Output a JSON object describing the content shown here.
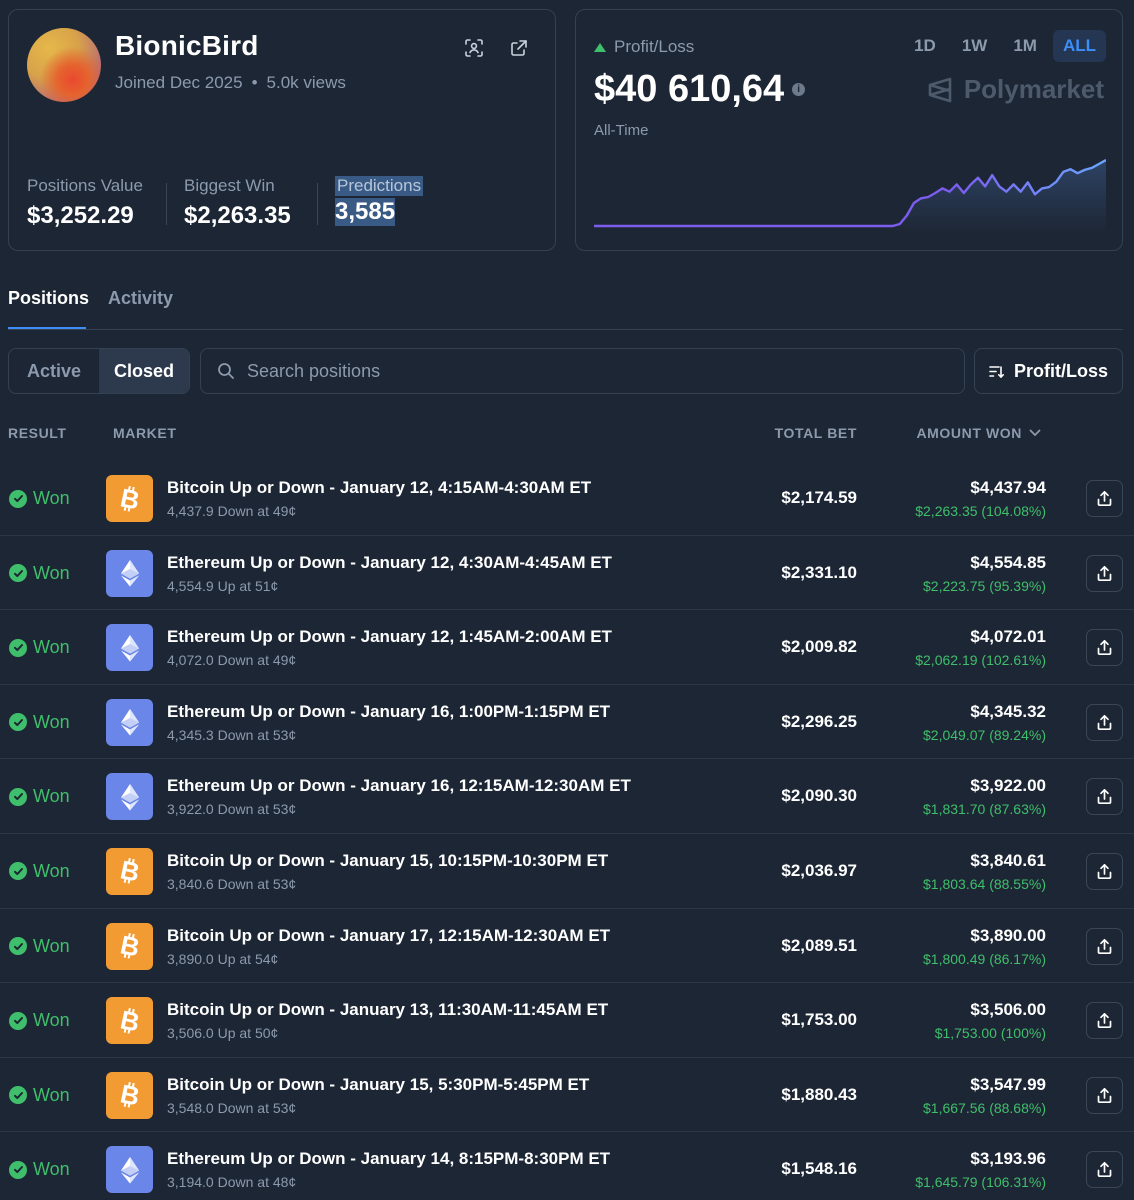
{
  "profile": {
    "username": "BionicBird",
    "joined": "Joined Dec 2025",
    "separator": "•",
    "views": "5.0k views",
    "icons": [
      "scan-icon",
      "external-link-icon"
    ],
    "stats": [
      {
        "label": "Positions Value",
        "value": "$3,252.29"
      },
      {
        "label": "Biggest Win",
        "value": "$2,263.35"
      },
      {
        "label": "Predictions",
        "value": "3,585"
      }
    ]
  },
  "pnl": {
    "label": "Profit/Loss",
    "value": "$40 610,64",
    "info": "i",
    "period": "All-Time",
    "ranges": [
      "1D",
      "1W",
      "1M",
      "ALL"
    ],
    "active_range": "ALL",
    "brand": "Polymarket",
    "trend_color": "#3fbf6b",
    "line_color": "#7d5cf0",
    "line_color_end": "#6aa7ff"
  },
  "tabs": {
    "positions": "Positions",
    "activity": "Activity",
    "active": "Positions"
  },
  "filter": {
    "active": "Active",
    "closed": "Closed",
    "selected": "Closed"
  },
  "search": {
    "placeholder": "Search positions"
  },
  "sort": {
    "label": "Profit/Loss"
  },
  "columns": {
    "result": "RESULT",
    "market": "MARKET",
    "total_bet": "TOTAL BET",
    "amount_won": "AMOUNT WON"
  },
  "colors": {
    "won": "#3fbf6b",
    "btc": "#f29b33",
    "eth": "#6a86e8",
    "accent": "#3d8ef7"
  },
  "rows": [
    {
      "result": "Won",
      "coin": "btc",
      "title": "Bitcoin Up or Down - January 12, 4:15AM-4:30AM ET",
      "sub": "4,437.9 Down at 49¢",
      "bet": "$2,174.59",
      "won": "$4,437.94",
      "gain": "$2,263.35 (104.08%)"
    },
    {
      "result": "Won",
      "coin": "eth",
      "title": "Ethereum Up or Down - January 12, 4:30AM-4:45AM ET",
      "sub": "4,554.9 Up at 51¢",
      "bet": "$2,331.10",
      "won": "$4,554.85",
      "gain": "$2,223.75 (95.39%)"
    },
    {
      "result": "Won",
      "coin": "eth",
      "title": "Ethereum Up or Down - January 12, 1:45AM-2:00AM ET",
      "sub": "4,072.0 Down at 49¢",
      "bet": "$2,009.82",
      "won": "$4,072.01",
      "gain": "$2,062.19 (102.61%)"
    },
    {
      "result": "Won",
      "coin": "eth",
      "title": "Ethereum Up or Down - January 16, 1:00PM-1:15PM ET",
      "sub": "4,345.3 Down at 53¢",
      "bet": "$2,296.25",
      "won": "$4,345.32",
      "gain": "$2,049.07 (89.24%)"
    },
    {
      "result": "Won",
      "coin": "eth",
      "title": "Ethereum Up or Down - January 16, 12:15AM-12:30AM ET",
      "sub": "3,922.0 Down at 53¢",
      "bet": "$2,090.30",
      "won": "$3,922.00",
      "gain": "$1,831.70 (87.63%)"
    },
    {
      "result": "Won",
      "coin": "btc",
      "title": "Bitcoin Up or Down - January 15, 10:15PM-10:30PM ET",
      "sub": "3,840.6 Down at 53¢",
      "bet": "$2,036.97",
      "won": "$3,840.61",
      "gain": "$1,803.64 (88.55%)"
    },
    {
      "result": "Won",
      "coin": "btc",
      "title": "Bitcoin Up or Down - January 17, 12:15AM-12:30AM ET",
      "sub": "3,890.0 Up at 54¢",
      "bet": "$2,089.51",
      "won": "$3,890.00",
      "gain": "$1,800.49 (86.17%)"
    },
    {
      "result": "Won",
      "coin": "btc",
      "title": "Bitcoin Up or Down - January 13, 11:30AM-11:45AM ET",
      "sub": "3,506.0 Up at 50¢",
      "bet": "$1,753.00",
      "won": "$3,506.00",
      "gain": "$1,753.00 (100%)"
    },
    {
      "result": "Won",
      "coin": "btc",
      "title": "Bitcoin Up or Down - January 15, 5:30PM-5:45PM ET",
      "sub": "3,548.0 Down at 53¢",
      "bet": "$1,880.43",
      "won": "$3,547.99",
      "gain": "$1,667.56 (88.68%)"
    },
    {
      "result": "Won",
      "coin": "eth",
      "title": "Ethereum Up or Down - January 14, 8:15PM-8:30PM ET",
      "sub": "3,194.0 Down at 48¢",
      "bet": "$1,548.16",
      "won": "$3,193.96",
      "gain": "$1,645.79 (106.31%)"
    }
  ],
  "chart_data": {
    "type": "area",
    "title": "",
    "xlabel": "",
    "ylabel": "",
    "series": [
      {
        "values": [
          0,
          0,
          0,
          0,
          0,
          0,
          0,
          0,
          0,
          0,
          0,
          0,
          0,
          0,
          0,
          0,
          0,
          0,
          0,
          0,
          0,
          0,
          0,
          0,
          0,
          0,
          0,
          0,
          0,
          0,
          0,
          0,
          0,
          0,
          0,
          0,
          0,
          0,
          0,
          0,
          0,
          0,
          0,
          0.03,
          0.16,
          0.35,
          0.42,
          0.44,
          0.5,
          0.57,
          0.52,
          0.63,
          0.5,
          0.63,
          0.73,
          0.6,
          0.77,
          0.6,
          0.52,
          0.63,
          0.52,
          0.66,
          0.48,
          0.57,
          0.59,
          0.67,
          0.82,
          0.86,
          0.8,
          0.85,
          0.88,
          0.94,
          1.0
        ]
      }
    ],
    "grid": false,
    "legend": "none"
  }
}
